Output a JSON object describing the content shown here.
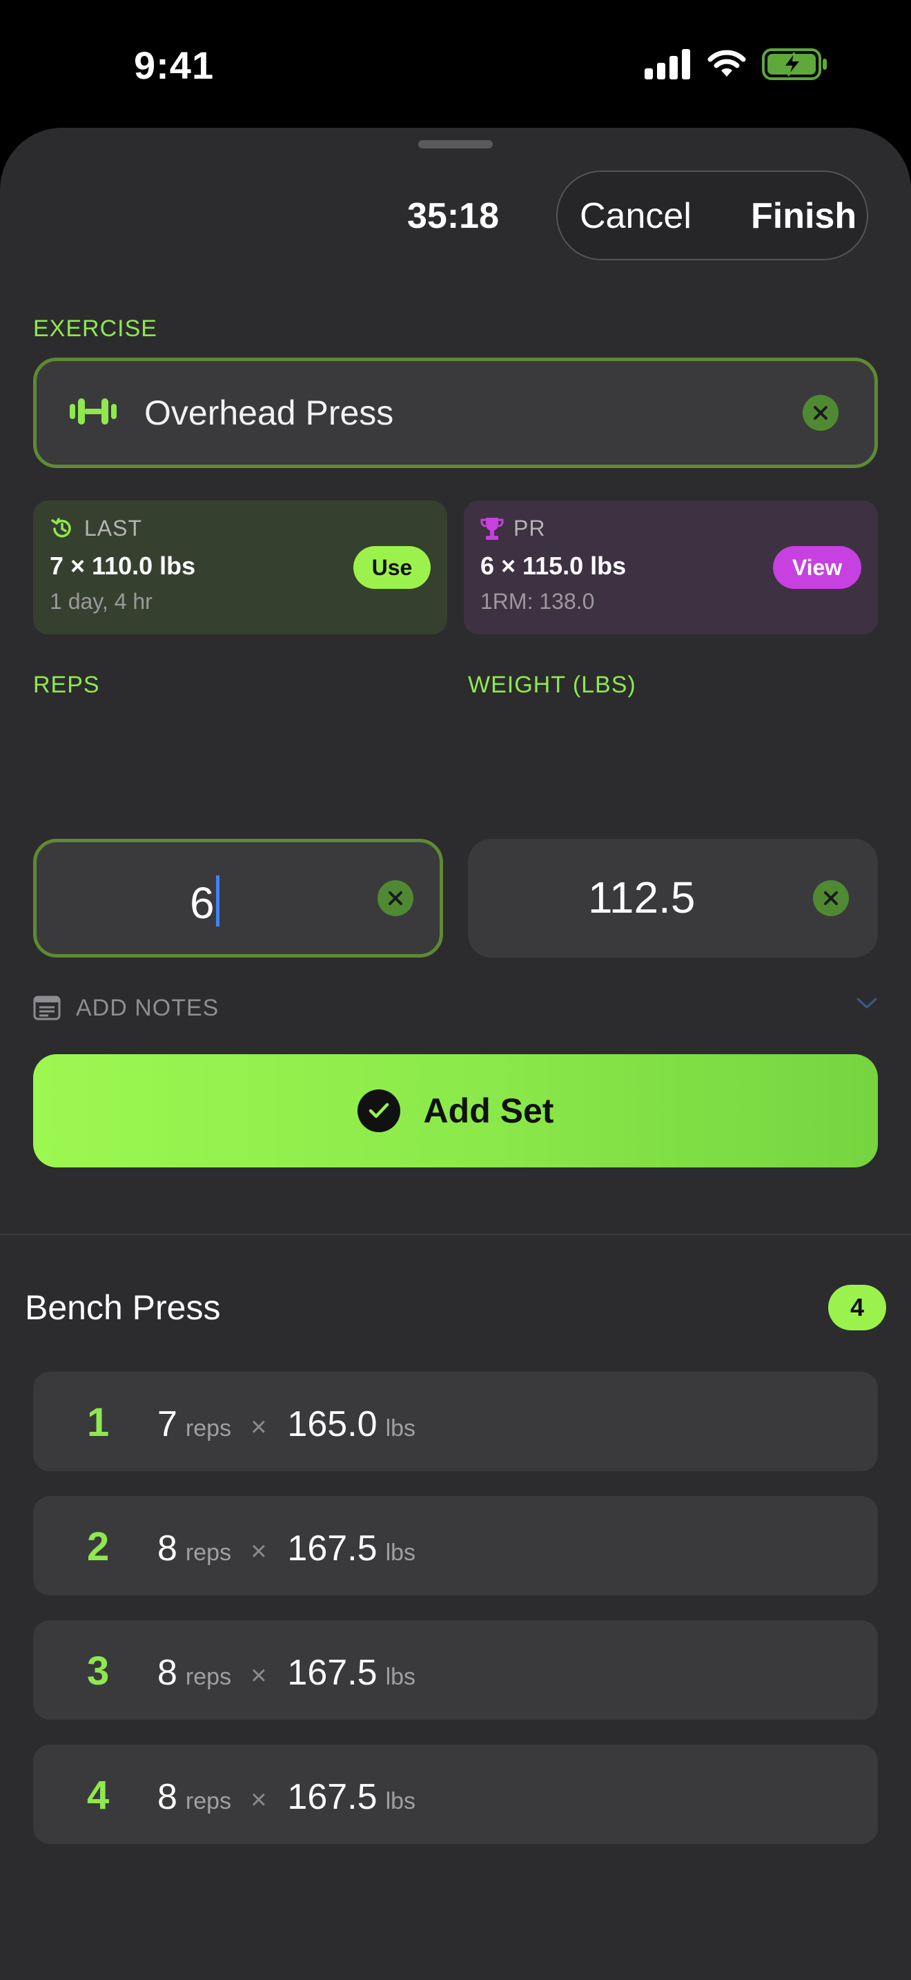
{
  "status": {
    "time": "9:41"
  },
  "header": {
    "timer": "35:18",
    "cancel_label": "Cancel",
    "finish_label": "Finish"
  },
  "exercise": {
    "section_label": "EXERCISE",
    "name": "Overhead Press"
  },
  "last_card": {
    "label": "LAST",
    "value": "7 × 110.0 lbs",
    "sub": "1 day, 4 hr",
    "action": "Use"
  },
  "pr_card": {
    "label": "PR",
    "value": "6 × 115.0 lbs",
    "sub": "1RM: 138.0",
    "action": "View"
  },
  "reps": {
    "label": "REPS",
    "value": "6"
  },
  "weight": {
    "label": "WEIGHT (LBS)",
    "value": "112.5"
  },
  "notes": {
    "label": "ADD NOTES"
  },
  "add_set": {
    "label": "Add Set"
  },
  "history": {
    "title": "Bench Press",
    "count": "4",
    "sets": [
      {
        "num": "1",
        "reps": "7",
        "reps_unit": "reps",
        "times": "×",
        "weight": "165.0",
        "weight_unit": "lbs"
      },
      {
        "num": "2",
        "reps": "8",
        "reps_unit": "reps",
        "times": "×",
        "weight": "167.5",
        "weight_unit": "lbs"
      },
      {
        "num": "3",
        "reps": "8",
        "reps_unit": "reps",
        "times": "×",
        "weight": "167.5",
        "weight_unit": "lbs"
      },
      {
        "num": "4",
        "reps": "8",
        "reps_unit": "reps",
        "times": "×",
        "weight": "167.5",
        "weight_unit": "lbs"
      }
    ]
  },
  "colors": {
    "accent": "#9cf24c",
    "pr_accent": "#c641e0",
    "sheet_bg": "#2c2c2e",
    "field_bg": "#3a3a3c"
  },
  "icons": [
    "signal-icon",
    "wifi-icon",
    "battery-charging-icon",
    "dumbbell-icon",
    "clear-icon",
    "history-icon",
    "trophy-icon",
    "notes-icon",
    "chevron-down-icon",
    "checkmark-icon"
  ]
}
